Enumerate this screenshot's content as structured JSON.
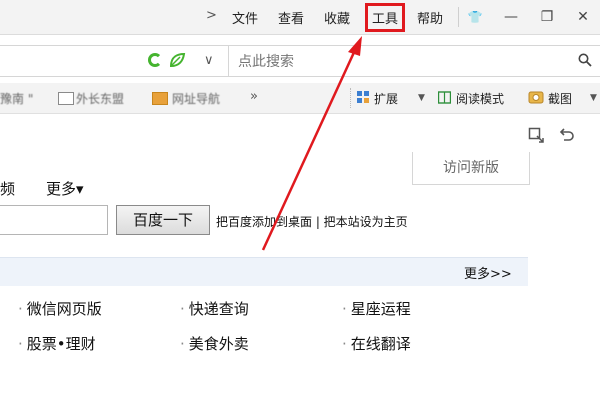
{
  "titlebar": {
    "nav_arrow": ">",
    "menu": [
      {
        "label": "文件"
      },
      {
        "label": "查看"
      },
      {
        "label": "收藏"
      },
      {
        "label": "工具"
      },
      {
        "label": "帮助"
      }
    ],
    "window_buttons": [
      {
        "icon": "shirt-icon",
        "glyph": "👕"
      },
      {
        "icon": "minimize-icon",
        "glyph": "—"
      },
      {
        "icon": "restore-icon",
        "glyph": "❐"
      },
      {
        "icon": "close-icon",
        "glyph": "✕"
      }
    ]
  },
  "addressbar": {
    "chevron": "∨",
    "search_placeholder": "点此搜索",
    "accent_green": "#45b42f"
  },
  "bookmarks": {
    "items": [
      "豫南 \"",
      "外长东盟",
      "网址导航"
    ],
    "overflow": "»",
    "tools": [
      {
        "icon": "extension-icon",
        "label": "扩展",
        "dropdown": "▼"
      },
      {
        "icon": "reading-mode-icon",
        "label": "阅读模式"
      },
      {
        "icon": "screenshot-icon",
        "label": "截图",
        "dropdown": "▼"
      }
    ]
  },
  "page": {
    "visit_new": "访问新版",
    "nav_fragment": "频",
    "nav_more": "更多▾",
    "search_button": "百度一下",
    "home_links": "把百度添加到桌面 | 把本站设为主页",
    "section_more": "更多>>",
    "services": [
      [
        "微信网页版",
        "快递查询",
        "星座运程"
      ],
      [
        "股票•理财",
        "美食外卖",
        "在线翻译"
      ]
    ],
    "annotation_color": "#e0191e"
  }
}
